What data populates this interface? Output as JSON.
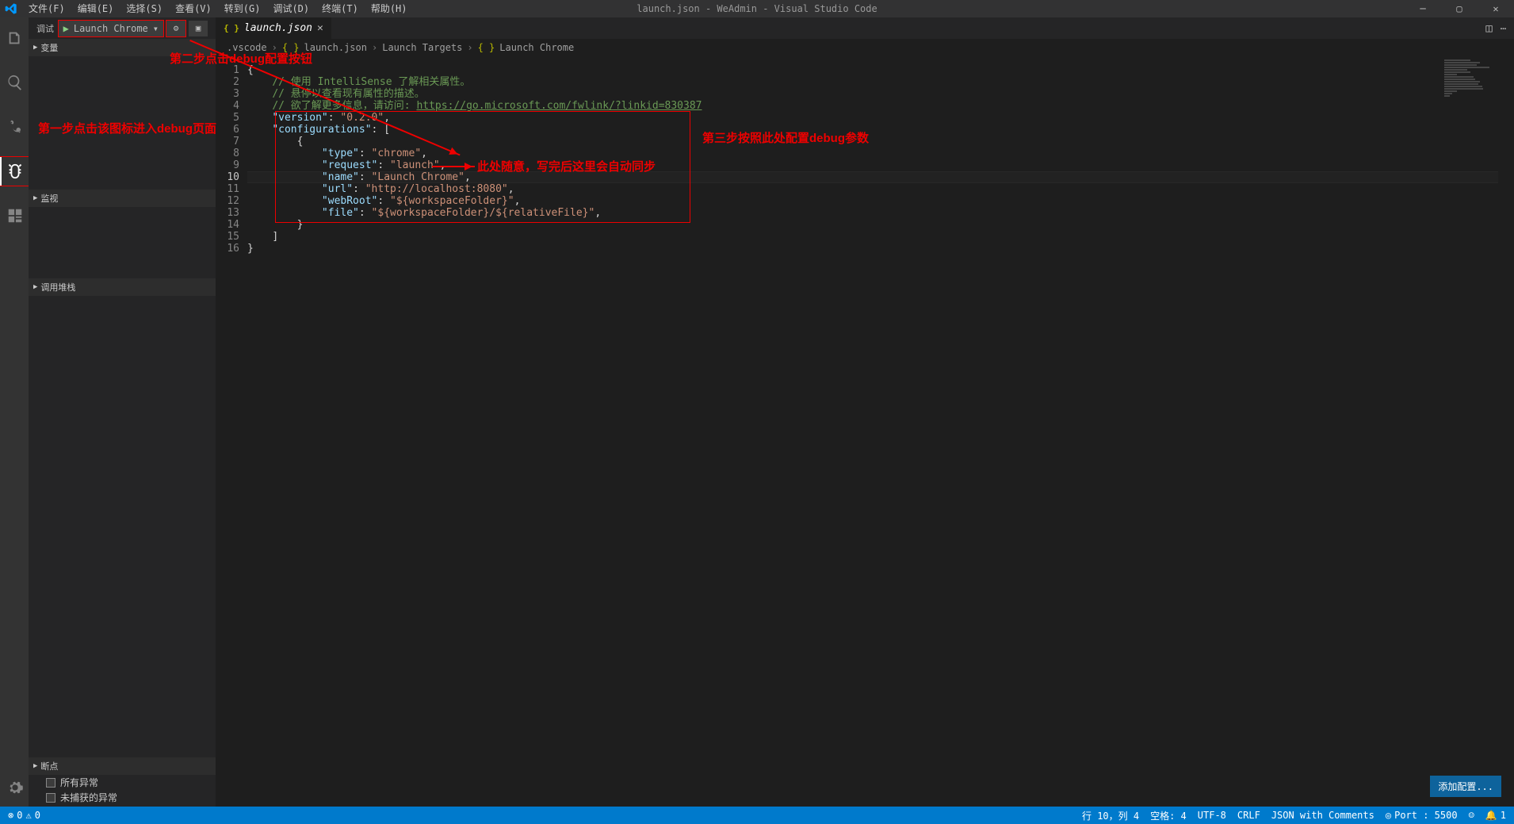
{
  "title": "launch.json - WeAdmin - Visual Studio Code",
  "menu": {
    "file": "文件(F)",
    "edit": "编辑(E)",
    "select": "选择(S)",
    "view": "查看(V)",
    "go": "转到(G)",
    "debug": "调试(D)",
    "terminal": "终端(T)",
    "help": "帮助(H)"
  },
  "sidebar": {
    "title": "调试",
    "config_label": "Launch Chrome",
    "sections": {
      "vars": "变量",
      "watch": "监视",
      "callstack": "调用堆栈",
      "breakpoints": "断点"
    },
    "breakpoints": {
      "all": "所有异常",
      "uncaught": "未捕获的异常"
    }
  },
  "tab": {
    "name": "launch.json"
  },
  "breadcrumbs": {
    "p0": ".vscode",
    "p1": "launch.json",
    "p2": "Launch Targets",
    "p3": "Launch Chrome"
  },
  "code": {
    "l1": "// 使用 IntelliSense 了解相关属性。",
    "l2": "// 悬停以查看现有属性的描述。",
    "l3_pre": "// 欲了解更多信息，请访问: ",
    "l3_link": "https://go.microsoft.com/fwlink/?linkid=830387",
    "ver_k": "\"version\"",
    "ver_v": "\"0.2.0\"",
    "conf_k": "\"configurations\"",
    "type_k": "\"type\"",
    "type_v": "\"chrome\"",
    "req_k": "\"request\"",
    "req_v": "\"launch\"",
    "name_k": "\"name\"",
    "name_v": "\"Launch Chrome\"",
    "url_k": "\"url\"",
    "url_v": "\"http://localhost:8080\"",
    "webroot_k": "\"webRoot\"",
    "webroot_v": "\"${workspaceFolder}\"",
    "file_k": "\"file\"",
    "file_v": "\"${workspaceFolder}/${relativeFile}\""
  },
  "annotations": {
    "step1": "第一步点击该图标进入debug页面",
    "step2": "第二步点击debug配置按钮",
    "step3": "第三步按照此处配置debug参数",
    "here": "此处随意，写完后这里会自动同步"
  },
  "editor_btn": {
    "add_config": "添加配置..."
  },
  "status": {
    "errors": "0",
    "warnings": "0",
    "ln_col": "行 10，列 4",
    "spaces": "空格: 4",
    "encoding": "UTF-8",
    "eol": "CRLF",
    "lang": "JSON with Comments",
    "port": "Port : 5500",
    "notifications": "1"
  }
}
